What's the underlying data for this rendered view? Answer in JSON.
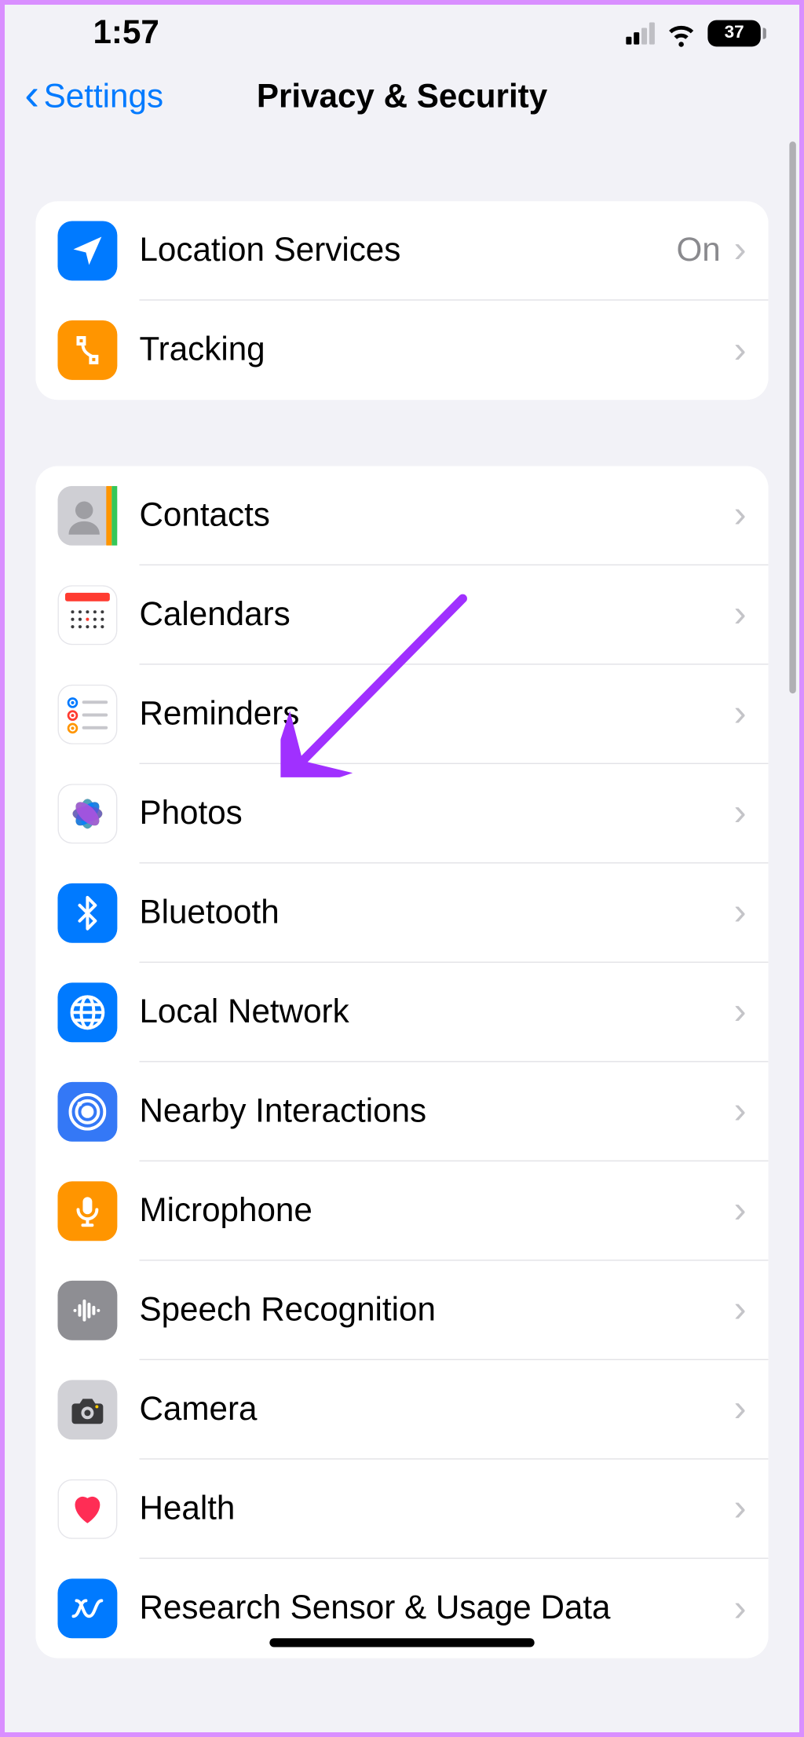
{
  "statusbar": {
    "time": "1:57",
    "battery_pct": "37"
  },
  "nav": {
    "back": "Settings",
    "title": "Privacy & Security"
  },
  "group1": [
    {
      "id": "location",
      "label": "Location Services",
      "value": "On"
    },
    {
      "id": "tracking",
      "label": "Tracking"
    }
  ],
  "group2": [
    {
      "id": "contacts",
      "label": "Contacts"
    },
    {
      "id": "calendars",
      "label": "Calendars"
    },
    {
      "id": "reminders",
      "label": "Reminders"
    },
    {
      "id": "photos",
      "label": "Photos"
    },
    {
      "id": "bluetooth",
      "label": "Bluetooth"
    },
    {
      "id": "localnet",
      "label": "Local Network"
    },
    {
      "id": "nearby",
      "label": "Nearby Interactions"
    },
    {
      "id": "microphone",
      "label": "Microphone"
    },
    {
      "id": "speech",
      "label": "Speech Recognition"
    },
    {
      "id": "camera",
      "label": "Camera"
    },
    {
      "id": "health",
      "label": "Health"
    },
    {
      "id": "research",
      "label": "Research Sensor & Usage Data"
    }
  ],
  "annotation": {
    "target": "localnet"
  }
}
